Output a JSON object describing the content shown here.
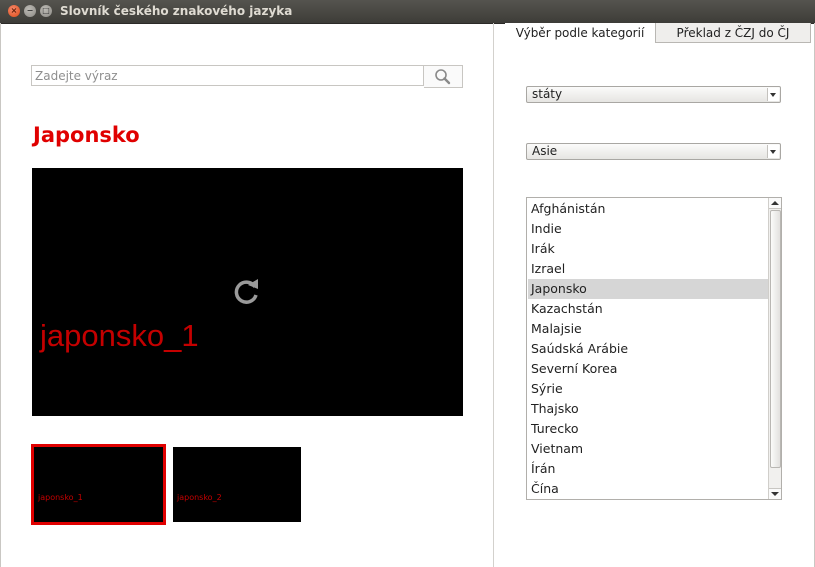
{
  "window": {
    "title": "Slovník českého znakového jazyka"
  },
  "search": {
    "placeholder": "Zadejte výraz",
    "value": ""
  },
  "word": {
    "title": "Japonsko"
  },
  "video": {
    "caption": "japonsko_1",
    "icon": "reload-icon"
  },
  "thumbnails": [
    {
      "caption": "japonsko_1",
      "selected": true
    },
    {
      "caption": "japonsko_2",
      "selected": false
    }
  ],
  "tabs": [
    {
      "label": "Výběr podle kategorií",
      "active": true
    },
    {
      "label": "Překlad z ČZJ do ČJ",
      "active": false
    }
  ],
  "category": {
    "selected": "státy"
  },
  "subcategory": {
    "selected": "Asie"
  },
  "countries": {
    "items": [
      "Afghánistán",
      "Indie",
      "Irák",
      "Izrael",
      "Japonsko",
      "Kazachstán",
      "Malajsie",
      "Saúdská Arábie",
      "Severní Korea",
      "Sýrie",
      "Thajsko",
      "Turecko",
      "Vietnam",
      "Írán",
      "Čína"
    ],
    "selected_index": 4
  },
  "colors": {
    "accent_red": "#e00000",
    "selection_gray": "#d6d6d6",
    "titlebar": "#3d3c38"
  }
}
